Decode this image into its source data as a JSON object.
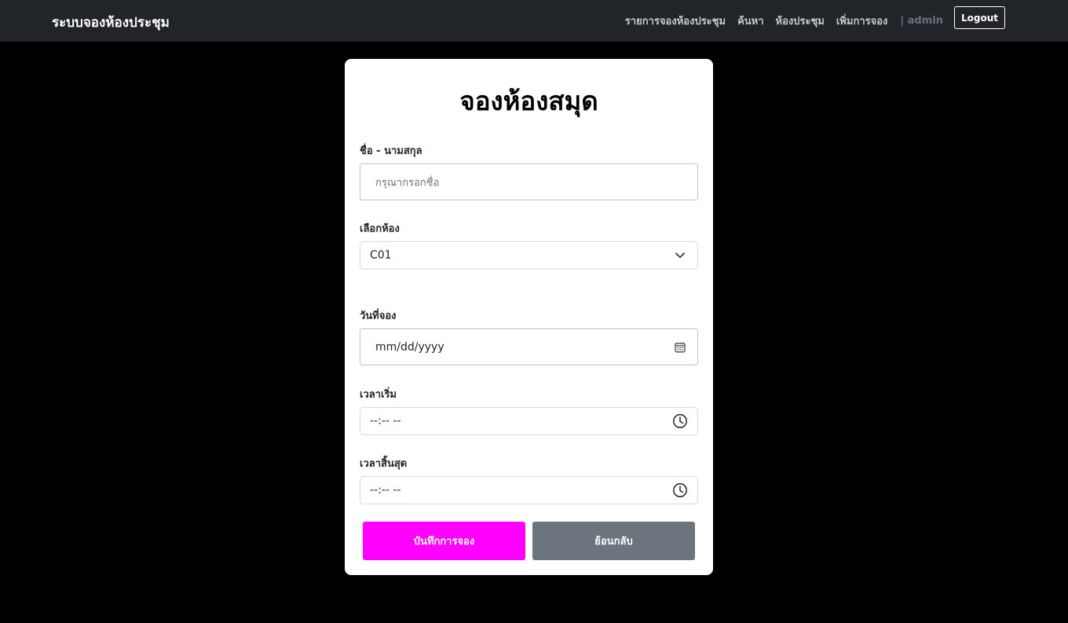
{
  "app": {
    "brand": "ระบบจองห้องประชุม"
  },
  "nav": {
    "items": [
      "รายการจองห้องประชุม",
      "ค้นหา",
      "ห้องประชุม",
      "เพิ่มการจอง"
    ],
    "user": "| admin",
    "logout_label": "Logout"
  },
  "form": {
    "title": "จองห้องสมุด",
    "name_label": "ชื่อ - นามสกุล",
    "name_placeholder": "กรุณากรอกชื่อ",
    "room_label": "เลือกห้อง",
    "room_value": "C01",
    "date_label": "วันที่จอง",
    "date_value": "mm/dd/yyyy",
    "start_label": "เวลาเริ่ม",
    "start_value": "--:-- --",
    "end_label": "เวลาสิ้นสุด",
    "end_value": "--:-- --",
    "save_label": "บันทึกการจอง",
    "back_label": "ย้อนกลับ"
  },
  "colors": {
    "navbar": "#212529",
    "save_button": "#ff00ff",
    "back_button": "#6c757d",
    "background": "#000000"
  },
  "icons": {
    "select": "chevron-down-icon",
    "date": "calendar-icon",
    "time": "clock-icon"
  }
}
